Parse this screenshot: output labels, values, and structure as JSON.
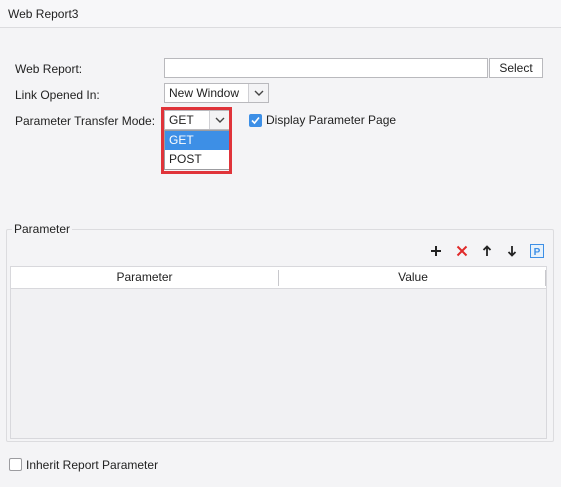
{
  "window": {
    "title": "Web Report3"
  },
  "form": {
    "web_report_label": "Web Report:",
    "web_report_value": "",
    "select_button": "Select",
    "link_opened_label": "Link Opened In:",
    "link_opened_value": "New Window",
    "transfer_mode_label": "Parameter Transfer Mode:",
    "transfer_mode_value": "GET",
    "transfer_mode_options": [
      "GET",
      "POST"
    ],
    "display_parameter_label": "Display Parameter Page",
    "display_parameter_checked": true
  },
  "parameter_section": {
    "legend": "Parameter",
    "toolbar_icons": [
      "add-icon",
      "delete-icon",
      "move-up-icon",
      "move-down-icon",
      "parameter-icon"
    ],
    "columns": [
      "Parameter",
      "Value"
    ],
    "rows": []
  },
  "inherit": {
    "label": "Inherit Report Parameter",
    "checked": false
  },
  "colors": {
    "accent": "#3d8fe6",
    "highlight": "#e0343a",
    "delete": "#e02a2a"
  }
}
